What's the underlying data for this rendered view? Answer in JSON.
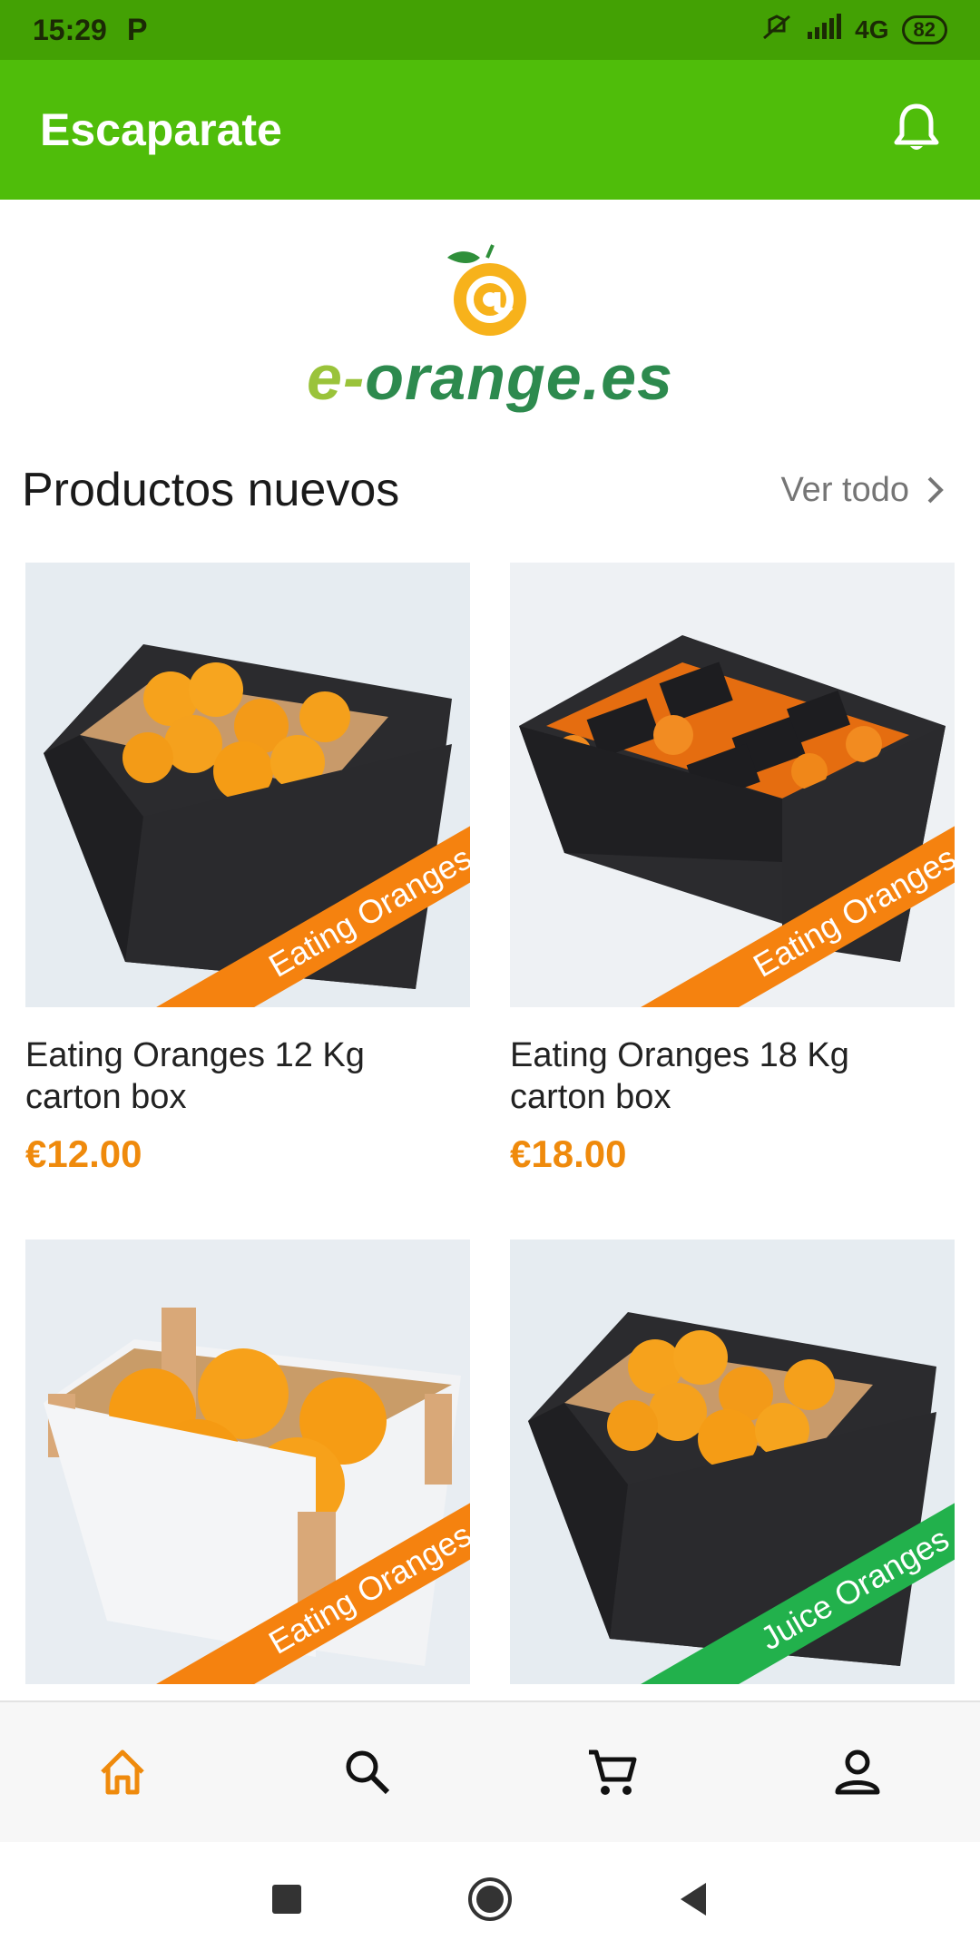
{
  "status_bar": {
    "time": "15:29",
    "app_icon": "P",
    "network": "4G",
    "battery": "82",
    "icons": [
      "silent-icon",
      "signal-icon",
      "battery-icon"
    ]
  },
  "app_bar": {
    "title": "Escaparate",
    "notification_icon": "bell-icon"
  },
  "logo": {
    "text_prefix": "e-",
    "text_rest": "orange.es"
  },
  "section": {
    "title": "Productos nuevos",
    "see_all": "Ver todo"
  },
  "products": [
    {
      "title": "Eating Oranges 12 Kg carton box",
      "price": "€12.00",
      "ribbon": "Eating Oranges",
      "ribbon_color": "#f5820f"
    },
    {
      "title": "Eating Oranges 18 Kg carton box",
      "price": "€18.00",
      "ribbon": "Eating Oranges",
      "ribbon_color": "#f5820f"
    },
    {
      "title": "",
      "price": "",
      "ribbon": "Eating Oranges",
      "ribbon_color": "#f5820f"
    },
    {
      "title": "",
      "price": "",
      "ribbon": "Juice Oranges",
      "ribbon_color": "#22b14c"
    }
  ],
  "bottom_nav": [
    {
      "icon": "home-icon",
      "active": true
    },
    {
      "icon": "search-icon",
      "active": false
    },
    {
      "icon": "cart-icon",
      "active": false
    },
    {
      "icon": "profile-icon",
      "active": false
    }
  ],
  "colors": {
    "accent": "#4fbd0a",
    "status_bar": "#43a104",
    "price": "#ef8a0c",
    "nav_active": "#ef8a0c"
  }
}
